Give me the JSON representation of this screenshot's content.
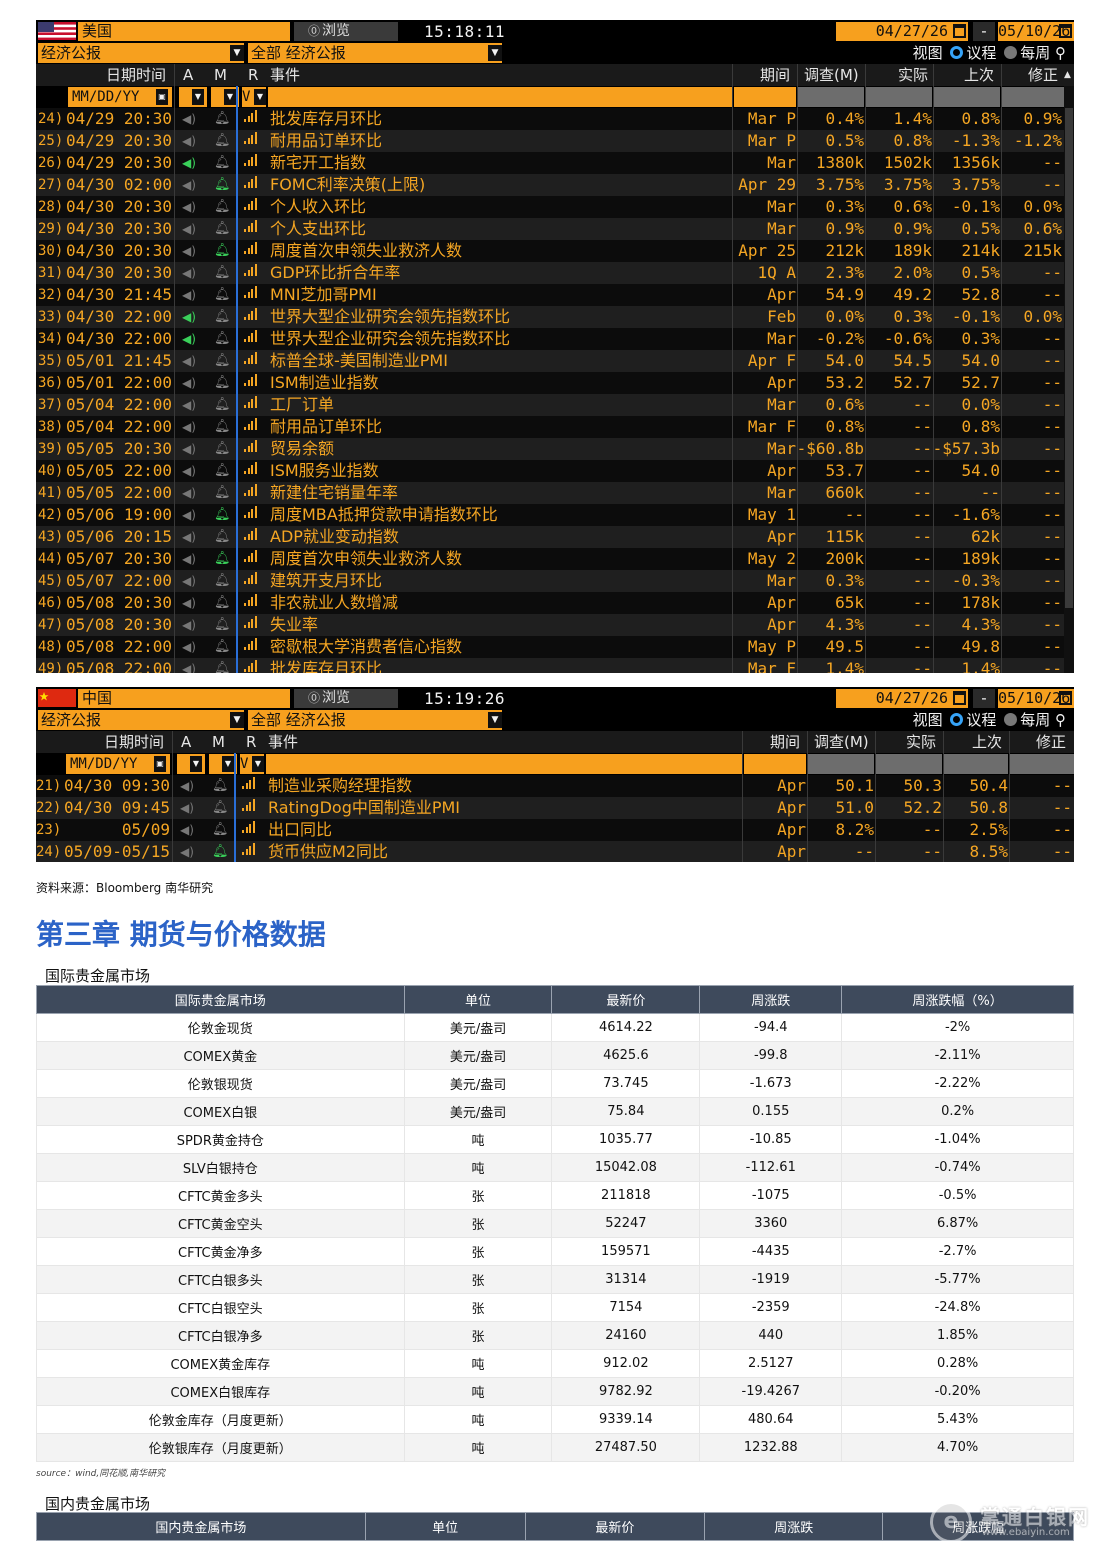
{
  "us": {
    "country": "美国",
    "browse": "浏览",
    "time": "15:18:11",
    "date_from": "04/27/26",
    "date_to": "05/10/26",
    "dash": "-",
    "category": "经济公报",
    "filter": "全部 经济公报",
    "view": "视图",
    "agenda": "议程",
    "weekly": "每周",
    "columns": {
      "datetime": "日期时间",
      "a": "A",
      "m": "M",
      "r": "R",
      "event": "事件",
      "period": "期间",
      "survey": "调查(M)",
      "actual": "实际",
      "prior": "上次",
      "revised": "修正"
    },
    "date_format": "MM/DD/YY",
    "r_value": "V",
    "rows": [
      {
        "no": "24)",
        "dt": "04/29 20:30",
        "spk": false,
        "bell": false,
        "event": "批发库存月环比",
        "period": "Mar P",
        "survey": "0.4%",
        "actual": "1.4%",
        "prior": "0.8%",
        "revised": "0.9%"
      },
      {
        "no": "25)",
        "dt": "04/29 20:30",
        "spk": false,
        "bell": false,
        "event": "耐用品订单环比",
        "period": "Mar P",
        "survey": "0.5%",
        "actual": "0.8%",
        "prior": "-1.3%",
        "revised": "-1.2%"
      },
      {
        "no": "26)",
        "dt": "04/29 20:30",
        "spk": true,
        "bell": false,
        "event": "新宅开工指数",
        "period": "Mar",
        "survey": "1380k",
        "actual": "1502k",
        "prior": "1356k",
        "revised": "--"
      },
      {
        "no": "27)",
        "dt": "04/30 02:00",
        "spk": false,
        "bell": true,
        "event": "FOMC利率决策(上限)",
        "period": "Apr 29",
        "survey": "3.75%",
        "actual": "3.75%",
        "prior": "3.75%",
        "revised": "--"
      },
      {
        "no": "28)",
        "dt": "04/30 20:30",
        "spk": false,
        "bell": false,
        "event": "个人收入环比",
        "period": "Mar",
        "survey": "0.3%",
        "actual": "0.6%",
        "prior": "-0.1%",
        "revised": "0.0%"
      },
      {
        "no": "29)",
        "dt": "04/30 20:30",
        "spk": false,
        "bell": false,
        "event": "个人支出环比",
        "period": "Mar",
        "survey": "0.9%",
        "actual": "0.9%",
        "prior": "0.5%",
        "revised": "0.6%"
      },
      {
        "no": "30)",
        "dt": "04/30 20:30",
        "spk": false,
        "bell": true,
        "event": "周度首次申领失业救济人数",
        "period": "Apr 25",
        "survey": "212k",
        "actual": "189k",
        "prior": "214k",
        "revised": "215k"
      },
      {
        "no": "31)",
        "dt": "04/30 20:30",
        "spk": false,
        "bell": false,
        "event": "GDP环比折合年率",
        "period": "1Q A",
        "survey": "2.3%",
        "actual": "2.0%",
        "prior": "0.5%",
        "revised": "--"
      },
      {
        "no": "32)",
        "dt": "04/30 21:45",
        "spk": false,
        "bell": false,
        "event": "MNI芝加哥PMI",
        "period": "Apr",
        "survey": "54.9",
        "actual": "49.2",
        "prior": "52.8",
        "revised": "--"
      },
      {
        "no": "33)",
        "dt": "04/30 22:00",
        "spk": true,
        "bell": false,
        "event": "世界大型企业研究会领先指数环比",
        "period": "Feb",
        "survey": "0.0%",
        "actual": "0.3%",
        "prior": "-0.1%",
        "revised": "0.0%"
      },
      {
        "no": "34)",
        "dt": "04/30 22:00",
        "spk": true,
        "bell": false,
        "event": "世界大型企业研究会领先指数环比",
        "period": "Mar",
        "survey": "-0.2%",
        "actual": "-0.6%",
        "prior": "0.3%",
        "revised": "--"
      },
      {
        "no": "35)",
        "dt": "05/01 21:45",
        "spk": false,
        "bell": false,
        "event": "标普全球-美国制造业PMI",
        "period": "Apr F",
        "survey": "54.0",
        "actual": "54.5",
        "prior": "54.0",
        "revised": "--"
      },
      {
        "no": "36)",
        "dt": "05/01 22:00",
        "spk": false,
        "bell": false,
        "event": "ISM制造业指数",
        "period": "Apr",
        "survey": "53.2",
        "actual": "52.7",
        "prior": "52.7",
        "revised": "--"
      },
      {
        "no": "37)",
        "dt": "05/04 22:00",
        "spk": false,
        "bell": false,
        "event": "工厂订单",
        "period": "Mar",
        "survey": "0.6%",
        "actual": "--",
        "prior": "0.0%",
        "revised": "--"
      },
      {
        "no": "38)",
        "dt": "05/04 22:00",
        "spk": false,
        "bell": false,
        "event": "耐用品订单环比",
        "period": "Mar F",
        "survey": "0.8%",
        "actual": "--",
        "prior": "0.8%",
        "revised": "--"
      },
      {
        "no": "39)",
        "dt": "05/05 20:30",
        "spk": false,
        "bell": false,
        "event": "贸易余额",
        "period": "Mar",
        "survey": "-$60.8b",
        "actual": "--",
        "prior": "-$57.3b",
        "revised": "--"
      },
      {
        "no": "40)",
        "dt": "05/05 22:00",
        "spk": false,
        "bell": false,
        "event": "ISM服务业指数",
        "period": "Apr",
        "survey": "53.7",
        "actual": "--",
        "prior": "54.0",
        "revised": "--"
      },
      {
        "no": "41)",
        "dt": "05/05 22:00",
        "spk": false,
        "bell": false,
        "event": "新建住宅销量年率",
        "period": "Mar",
        "survey": "660k",
        "actual": "--",
        "prior": "--",
        "revised": "--"
      },
      {
        "no": "42)",
        "dt": "05/06 19:00",
        "spk": false,
        "bell": true,
        "event": "周度MBA抵押贷款申请指数环比",
        "period": "May 1",
        "survey": "--",
        "actual": "--",
        "prior": "-1.6%",
        "revised": "--"
      },
      {
        "no": "43)",
        "dt": "05/06 20:15",
        "spk": false,
        "bell": false,
        "event": "ADP就业变动指数",
        "period": "Apr",
        "survey": "115k",
        "actual": "--",
        "prior": "62k",
        "revised": "--"
      },
      {
        "no": "44)",
        "dt": "05/07 20:30",
        "spk": false,
        "bell": true,
        "event": "周度首次申领失业救济人数",
        "period": "May 2",
        "survey": "200k",
        "actual": "--",
        "prior": "189k",
        "revised": "--"
      },
      {
        "no": "45)",
        "dt": "05/07 22:00",
        "spk": false,
        "bell": false,
        "event": "建筑开支月环比",
        "period": "Mar",
        "survey": "0.3%",
        "actual": "--",
        "prior": "-0.3%",
        "revised": "--"
      },
      {
        "no": "46)",
        "dt": "05/08 20:30",
        "spk": false,
        "bell": false,
        "event": "非农就业人数增减",
        "period": "Apr",
        "survey": "65k",
        "actual": "--",
        "prior": "178k",
        "revised": "--"
      },
      {
        "no": "47)",
        "dt": "05/08 20:30",
        "spk": false,
        "bell": false,
        "event": "失业率",
        "period": "Apr",
        "survey": "4.3%",
        "actual": "--",
        "prior": "4.3%",
        "revised": "--"
      },
      {
        "no": "48)",
        "dt": "05/08 22:00",
        "spk": false,
        "bell": false,
        "event": "密歇根大学消费者信心指数",
        "period": "May P",
        "survey": "49.5",
        "actual": "--",
        "prior": "49.8",
        "revised": "--"
      },
      {
        "no": "49)",
        "dt": "05/08 22:00",
        "spk": false,
        "bell": false,
        "event": "批发库存月环比",
        "period": "Mar F",
        "survey": "1.4%",
        "actual": "--",
        "prior": "1.4%",
        "revised": "--"
      }
    ]
  },
  "cn": {
    "country": "中国",
    "browse": "浏览",
    "time": "15:19:26",
    "date_from": "04/27/26",
    "date_to": "05/10/26",
    "dash": "-",
    "category": "经济公报",
    "filter": "全部 经济公报",
    "view": "视图",
    "agenda": "议程",
    "weekly": "每周",
    "columns": {
      "datetime": "日期时间",
      "a": "A",
      "m": "M",
      "r": "R",
      "event": "事件",
      "period": "期间",
      "survey": "调查(M)",
      "actual": "实际",
      "prior": "上次",
      "revised": "修正"
    },
    "date_format": "MM/DD/YY",
    "r_value": "V",
    "rows": [
      {
        "no": "21)",
        "dt": "04/30 09:30",
        "spk": false,
        "bell": false,
        "event": "制造业采购经理指数",
        "period": "Apr",
        "survey": "50.1",
        "actual": "50.3",
        "prior": "50.4",
        "revised": "--"
      },
      {
        "no": "22)",
        "dt": "04/30 09:45",
        "spk": false,
        "bell": false,
        "event": "RatingDog中国制造业PMI",
        "period": "Apr",
        "survey": "51.0",
        "actual": "52.2",
        "prior": "50.8",
        "revised": "--"
      },
      {
        "no": "23)",
        "dt": "05/09",
        "spk": false,
        "bell": false,
        "event": "出口同比",
        "period": "Apr",
        "survey": "8.2%",
        "actual": "--",
        "prior": "2.5%",
        "revised": "--"
      },
      {
        "no": "24)",
        "dt": "05/09-05/15",
        "spk": false,
        "bell": true,
        "event": "货币供应M2同比",
        "period": "Apr",
        "survey": "--",
        "actual": "--",
        "prior": "8.5%",
        "revised": "--"
      }
    ]
  },
  "source1": "资料来源：Bloomberg 南华研究",
  "chapter_title": "第三章 期货与价格数据",
  "intl_table": {
    "caption": "国际贵金属市场",
    "headers": [
      "国际贵金属市场",
      "单位",
      "最新价",
      "周涨跌",
      "周涨跌幅（%）"
    ],
    "rows": [
      [
        "伦敦金现货",
        "美元/盎司",
        "4614.22",
        "-94.4",
        "-2%"
      ],
      [
        "COMEX黄金",
        "美元/盎司",
        "4625.6",
        "-99.8",
        "-2.11%"
      ],
      [
        "伦敦银现货",
        "美元/盎司",
        "73.745",
        "-1.673",
        "-2.22%"
      ],
      [
        "COMEX白银",
        "美元/盎司",
        "75.84",
        "0.155",
        "0.2%"
      ],
      [
        "SPDR黄金持仓",
        "吨",
        "1035.77",
        "-10.85",
        "-1.04%"
      ],
      [
        "SLV白银持仓",
        "吨",
        "15042.08",
        "-112.61",
        "-0.74%"
      ],
      [
        "CFTC黄金多头",
        "张",
        "211818",
        "-1075",
        "-0.5%"
      ],
      [
        "CFTC黄金空头",
        "张",
        "52247",
        "3360",
        "6.87%"
      ],
      [
        "CFTC黄金净多",
        "张",
        "159571",
        "-4435",
        "-2.7%"
      ],
      [
        "CFTC白银多头",
        "张",
        "31314",
        "-1919",
        "-5.77%"
      ],
      [
        "CFTC白银空头",
        "张",
        "7154",
        "-2359",
        "-24.8%"
      ],
      [
        "CFTC白银净多",
        "张",
        "24160",
        "440",
        "1.85%"
      ],
      [
        "COMEX黄金库存",
        "吨",
        "912.02",
        "2.5127",
        "0.28%"
      ],
      [
        "COMEX白银库存",
        "吨",
        "9782.92",
        "-19.4267",
        "-0.20%"
      ],
      [
        "伦敦金库存（月度更新）",
        "吨",
        "9339.14",
        "480.64",
        "5.43%"
      ],
      [
        "伦敦银库存（月度更新）",
        "吨",
        "27487.50",
        "1232.88",
        "4.70%"
      ]
    ],
    "source": "source：wind,同花顺,南华研究"
  },
  "dom_table": {
    "caption": "国内贵金属市场",
    "headers": [
      "国内贵金属市场",
      "单位",
      "最新价",
      "周涨跌",
      "周涨跌幅"
    ]
  },
  "watermark": {
    "name": "掌通白银网",
    "url": "www.ebaiyin.com",
    "logo": "e"
  }
}
